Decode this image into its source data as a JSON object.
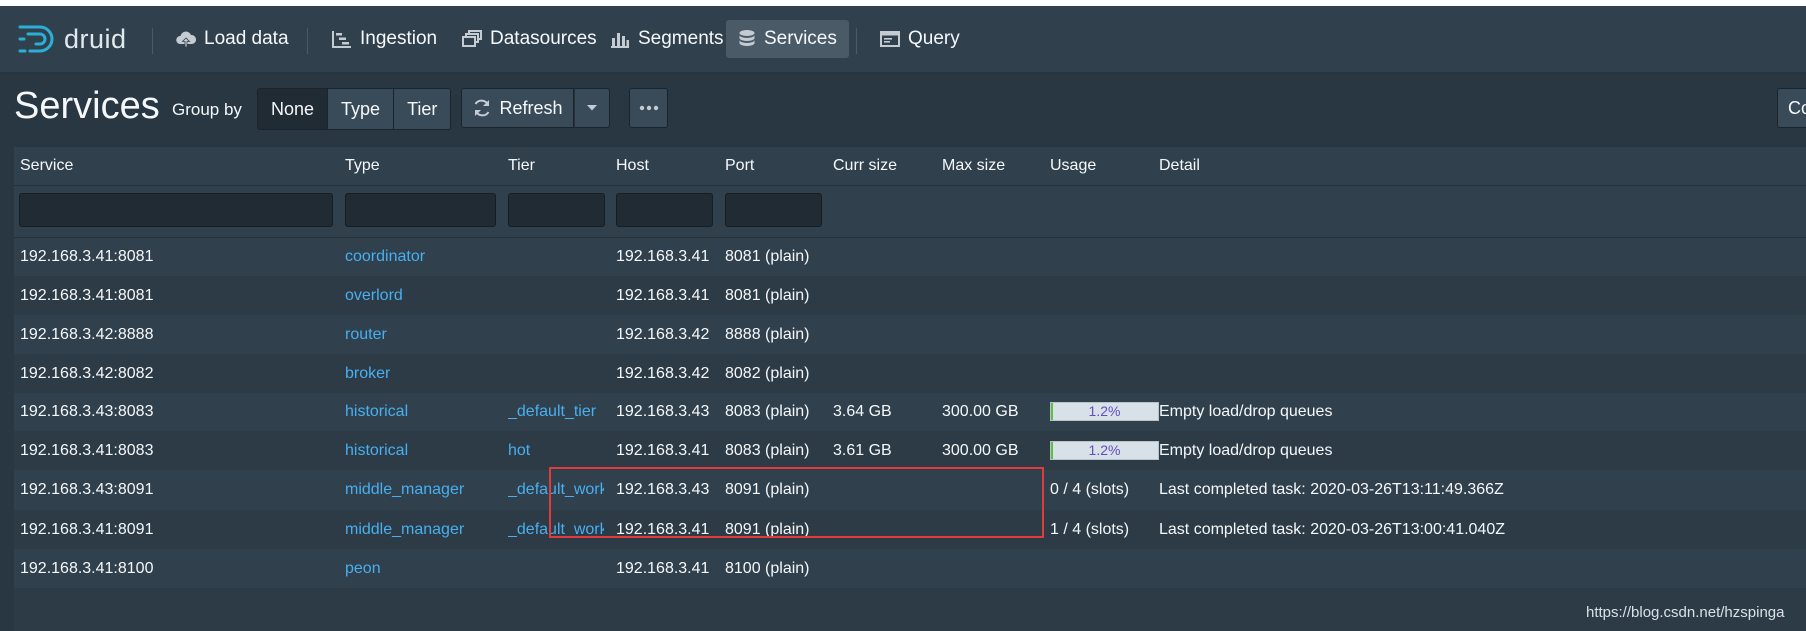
{
  "app": {
    "logo_text": "druid"
  },
  "nav": {
    "items": [
      {
        "label": "Load data",
        "icon": "cloud-upload-icon"
      },
      {
        "label": "Ingestion",
        "icon": "gantt-chart-icon"
      },
      {
        "label": "Datasources",
        "icon": "multi-select-icon"
      },
      {
        "label": "Segments",
        "icon": "stacked-chart-icon"
      },
      {
        "label": "Services",
        "icon": "database-icon",
        "active": true
      },
      {
        "label": "Query",
        "icon": "application-icon"
      }
    ]
  },
  "toolbar": {
    "title": "Services",
    "group_by_label": "Group by",
    "group_by_options": [
      "None",
      "Type",
      "Tier"
    ],
    "group_by_selected": "None",
    "refresh_label": "Refresh",
    "columns_label": "Co"
  },
  "table": {
    "columns": [
      "Service",
      "Type",
      "Tier",
      "Host",
      "Port",
      "Curr size",
      "Max size",
      "Usage",
      "Detail"
    ],
    "rows": [
      {
        "service": "192.168.3.41:8081",
        "type": "coordinator",
        "tier": "",
        "host": "192.168.3.41",
        "port": "8081 (plain)",
        "curr": "",
        "max": "",
        "usage": "",
        "detail": ""
      },
      {
        "service": "192.168.3.41:8081",
        "type": "overlord",
        "tier": "",
        "host": "192.168.3.41",
        "port": "8081 (plain)",
        "curr": "",
        "max": "",
        "usage": "",
        "detail": ""
      },
      {
        "service": "192.168.3.42:8888",
        "type": "router",
        "tier": "",
        "host": "192.168.3.42",
        "port": "8888 (plain)",
        "curr": "",
        "max": "",
        "usage": "",
        "detail": ""
      },
      {
        "service": "192.168.3.42:8082",
        "type": "broker",
        "tier": "",
        "host": "192.168.3.42",
        "port": "8082 (plain)",
        "curr": "",
        "max": "",
        "usage": "",
        "detail": ""
      },
      {
        "service": "192.168.3.43:8083",
        "type": "historical",
        "tier": "_default_tier",
        "host": "192.168.3.43",
        "port": "8083 (plain)",
        "curr": "3.64 GB",
        "max": "300.00 GB",
        "usage": "1.2%",
        "usage_fraction": 0.012,
        "detail": "Empty load/drop queues"
      },
      {
        "service": "192.168.3.41:8083",
        "type": "historical",
        "tier": "hot",
        "host": "192.168.3.41",
        "port": "8083 (plain)",
        "curr": "3.61 GB",
        "max": "300.00 GB",
        "usage": "1.2%",
        "usage_fraction": 0.012,
        "detail": "Empty load/drop queues"
      },
      {
        "service": "192.168.3.43:8091",
        "type": "middle_manager",
        "tier": "_default_work...",
        "host": "192.168.3.43",
        "port": "8091 (plain)",
        "curr": "",
        "max": "",
        "usage": "0 / 4 (slots)",
        "detail": "Last completed task: 2020-03-26T13:11:49.366Z"
      },
      {
        "service": "192.168.3.41:8091",
        "type": "middle_manager",
        "tier": "_default_work...",
        "host": "192.168.3.41",
        "port": "8091 (plain)",
        "curr": "",
        "max": "",
        "usage": "1 / 4 (slots)",
        "detail": "Last completed task: 2020-03-26T13:00:41.040Z"
      },
      {
        "service": "192.168.3.41:8100",
        "type": "peon",
        "tier": "",
        "host": "192.168.3.41",
        "port": "8100 (plain)",
        "curr": "",
        "max": "",
        "usage": "",
        "detail": ""
      }
    ]
  },
  "watermark": "https://blog.csdn.net/hzspinga",
  "colors": {
    "navbar": "#30404d",
    "link": "#48aff0",
    "highlight": "#e23b3b",
    "usage_fill": "#5fbf3a"
  }
}
